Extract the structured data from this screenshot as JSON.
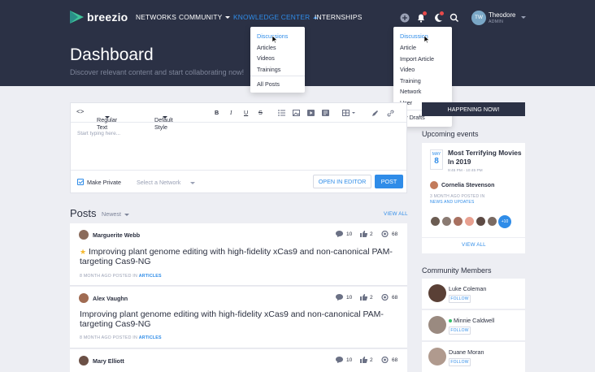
{
  "app": {
    "brand": "breezio"
  },
  "nav": {
    "networks": "NETWORKS",
    "community": "COMMUNITY",
    "knowledge": "KNOWLEDGE CENTER",
    "internships": "INTERNSHIPS"
  },
  "user": {
    "initials": "TW",
    "name": "Theodore",
    "role": "ADMIN"
  },
  "page": {
    "title": "Dashboard",
    "subtitle": "Discover relevant content and start collaborating now!"
  },
  "knowledge_menu": {
    "items": [
      "Discussions",
      "Articles",
      "Videos",
      "Trainings"
    ],
    "all": "All Posts"
  },
  "create_menu": {
    "items": [
      "Discussion",
      "Article",
      "Import Article",
      "Video",
      "Training",
      "Network",
      "User"
    ],
    "drafts": "My Drafts"
  },
  "editor": {
    "format": "Regular Text",
    "style": "Default Style",
    "placeholder": "Start typing here...",
    "private_label": "Make Private",
    "network_placeholder": "Select a Network",
    "open_editor": "OPEN IN EDITOR",
    "post": "POST"
  },
  "posts": {
    "heading": "Posts",
    "sort": "Newest",
    "view_all": "VIEW ALL",
    "items": [
      {
        "author": "Marguerite Webb",
        "comments": "10",
        "likes": "2",
        "views": "68",
        "starred": true,
        "text": "Improving plant genome editing with high-fidelity xCas9 and non-canonical PAM-targeting Cas9-NG",
        "meta": "8 MONTH AGO POSTED IN",
        "category": "ARTICLES"
      },
      {
        "author": "Alex Vaughn",
        "comments": "10",
        "likes": "2",
        "views": "68",
        "starred": false,
        "text": "Improving plant genome editing with high-fidelity xCas9 and non-canonical PAM-targeting Cas9-NG",
        "meta": "8 MONTH AGO POSTED IN",
        "category": "ARTICLES"
      },
      {
        "author": "Mary Elliott",
        "comments": "10",
        "likes": "2",
        "views": "68"
      }
    ]
  },
  "sidebar": {
    "happening": "HAPPENING NOW!",
    "events_heading": "Upcoming events",
    "event": {
      "month": "MAY",
      "day": "8",
      "title": "Most Terrifying Movies In 2019",
      "time": "9:45 PM - 10:45 PM",
      "host": "Cornelia Stevenson",
      "meta": "3 MONTH AGO POSTED IN",
      "category": "NEWS AND UPDATES",
      "more": "+10"
    },
    "view_all": "VIEW ALL",
    "members_heading": "Community Members",
    "members": [
      {
        "name": "Luke Coleman",
        "follow": "FOLLOW"
      },
      {
        "name": "Minnie Caldwell",
        "follow": "FOLLOW"
      },
      {
        "name": "Duane Moran",
        "follow": "FOLLOW"
      }
    ]
  },
  "colors": {
    "header": "#2b3145",
    "accent": "#2f8ce8",
    "background": "#edeef3"
  }
}
